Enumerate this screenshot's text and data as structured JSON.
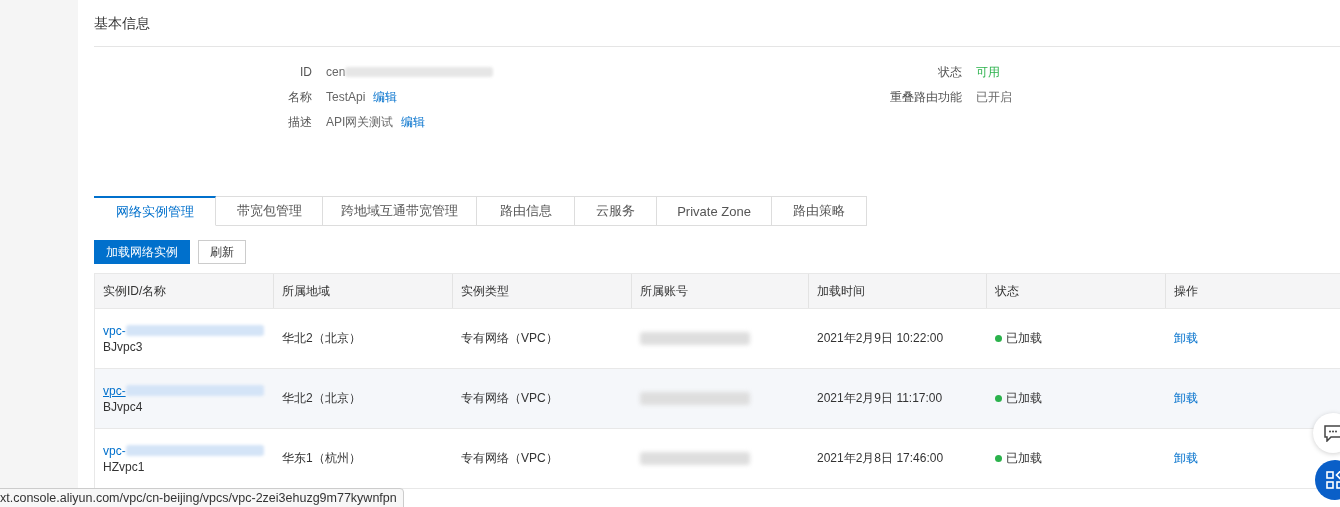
{
  "section_title": "基本信息",
  "info_left": [
    {
      "label": "ID",
      "value": "cen",
      "redacted": true
    },
    {
      "label": "名称",
      "value": "TestApi",
      "link": "编辑"
    },
    {
      "label": "描述",
      "value": "API网关测试",
      "link": "编辑"
    }
  ],
  "info_right": [
    {
      "label": "状态",
      "value": "可用",
      "kind": "status"
    },
    {
      "label": "重叠路由功能",
      "value": "已开启",
      "kind": "plain"
    }
  ],
  "tabs": [
    {
      "label": "网络实例管理",
      "selected": true
    },
    {
      "label": "带宽包管理",
      "selected": false
    },
    {
      "label": "跨地域互通带宽管理",
      "selected": false
    },
    {
      "label": "路由信息",
      "selected": false
    },
    {
      "label": "云服务",
      "selected": false
    },
    {
      "label": "Private Zone",
      "selected": false
    },
    {
      "label": "路由策略",
      "selected": false
    }
  ],
  "buttons": [
    {
      "label": "加载网络实例",
      "kind": "primary"
    },
    {
      "label": "刷新",
      "kind": "default"
    }
  ],
  "table": {
    "columns": [
      "实例ID/名称",
      "所属地域",
      "实例类型",
      "所属账号",
      "加载时间",
      "状态",
      "操作"
    ],
    "rows": [
      {
        "instance_id": "vpc-",
        "id_redacted": true,
        "name": "BJvpc3",
        "region": "华北2（北京）",
        "type": "专有网络（VPC）",
        "account_redacted": true,
        "loaded_at": "2021年2月9日 10:22:00",
        "status": "已加载",
        "color": "#2bb24c",
        "action": "卸载",
        "hovered": false
      },
      {
        "instance_id": "vpc-",
        "id_redacted": true,
        "name": "BJvpc4",
        "region": "华北2（北京）",
        "type": "专有网络（VPC）",
        "account_redacted": true,
        "loaded_at": "2021年2月9日 11:17:00",
        "status": "已加载",
        "color": "#2bb24c",
        "action": "卸载",
        "hovered": true
      },
      {
        "instance_id": "vpc-",
        "id_redacted": true,
        "name": "HZvpc1",
        "region": "华东1（杭州）",
        "type": "专有网络（VPC）",
        "account_redacted": true,
        "loaded_at": "2021年2月8日 17:46:00",
        "status": "已加载",
        "color": "#2bb24c",
        "action": "卸载",
        "hovered": false
      }
    ]
  },
  "status_bar": {
    "url": "xt.console.aliyun.com/vpc/cn-beijing/vpcs/vpc-2zei3ehuzg9m77kywnfpn"
  }
}
